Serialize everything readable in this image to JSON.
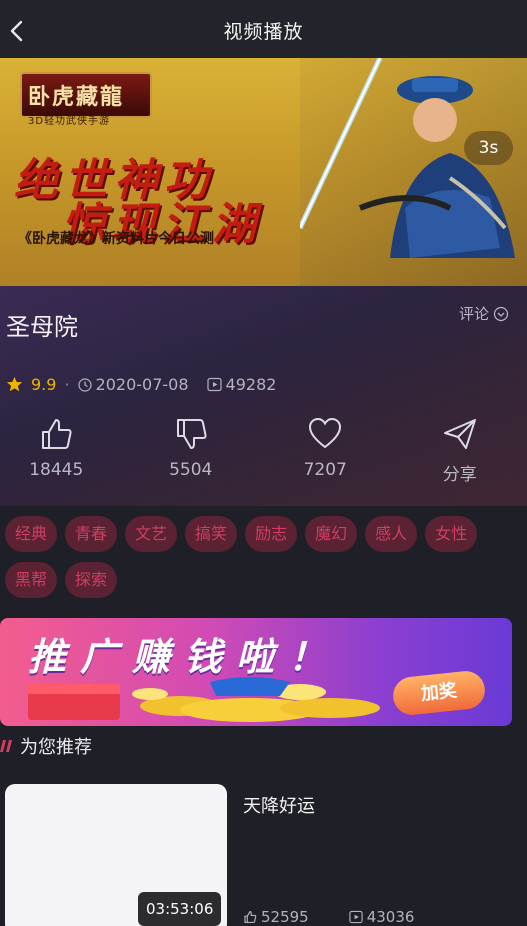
{
  "header": {
    "title": "视频播放"
  },
  "ad_banner": {
    "logo_text": "卧虎藏龍",
    "logo_subtitle": "3D轻功武侠手游",
    "headline_1": "绝世神功",
    "headline_2": "惊现江湖",
    "caption": "《卧虎藏龙》新资料片今日公测",
    "countdown": "3s"
  },
  "video": {
    "title": "圣母院",
    "comment_label": "评论",
    "score": "9.9",
    "date": "2020-07-08",
    "plays": "49282"
  },
  "actions": [
    {
      "name": "like",
      "label": "18445"
    },
    {
      "name": "dislike",
      "label": "5504"
    },
    {
      "name": "favorite",
      "label": "7207"
    },
    {
      "name": "share",
      "label": "分享"
    }
  ],
  "tags": [
    "经典",
    "青春",
    "文艺",
    "搞笑",
    "励志",
    "魔幻",
    "感人",
    "女性",
    "黑帮",
    "探索"
  ],
  "promo": {
    "text": "推广赚钱啦！",
    "button": "加奖"
  },
  "recommend": {
    "heading": "为您推荐",
    "items": [
      {
        "title": "天降好运",
        "duration": "03:53:06",
        "likes": "52595",
        "plays": "43036"
      }
    ]
  },
  "colors": {
    "accent": "#d23d63",
    "score": "#f0b400",
    "tag_bg": "#5a2232"
  }
}
